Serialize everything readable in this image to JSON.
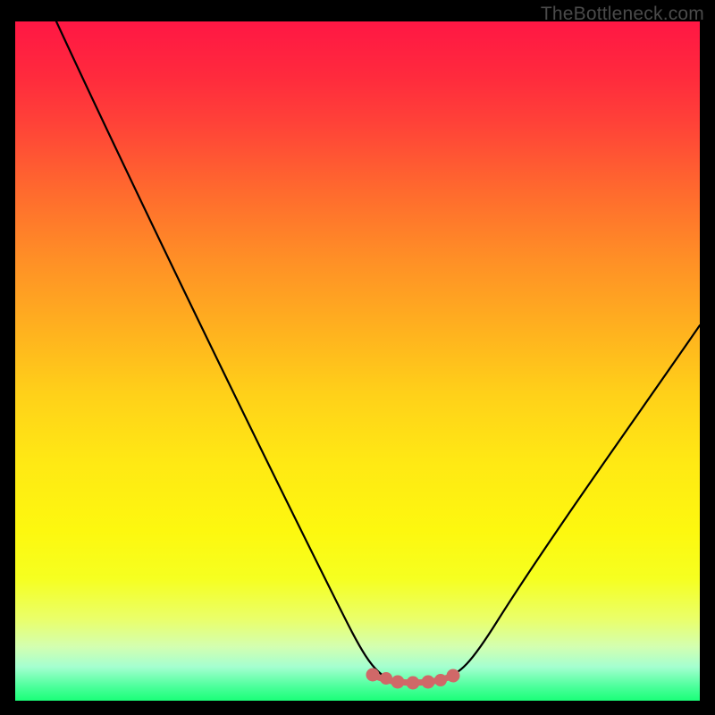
{
  "watermark": "TheBottleneck.com",
  "chart_data": {
    "type": "line",
    "title": "",
    "xlabel": "",
    "ylabel": "",
    "x_range": [
      0,
      100
    ],
    "y_range": [
      0,
      100
    ],
    "series": [
      {
        "name": "curve",
        "color": "#000000",
        "x": [
          6,
          10,
          15,
          20,
          25,
          30,
          35,
          40,
          45,
          48,
          50,
          52,
          55,
          57,
          59,
          61,
          63,
          66,
          70,
          75,
          80,
          85,
          90,
          95,
          100
        ],
        "values": [
          100,
          92,
          83,
          74,
          65,
          56,
          47,
          38,
          28,
          21,
          14,
          8,
          3,
          1,
          0,
          0,
          1,
          3,
          9,
          17,
          25,
          33,
          41,
          48,
          55
        ]
      },
      {
        "name": "optimal-band",
        "color": "#d96a6a",
        "x": [
          52,
          55,
          57,
          59,
          61,
          63,
          66
        ],
        "values": [
          3,
          1,
          0.5,
          0.3,
          0.3,
          0.8,
          2
        ]
      }
    ],
    "gradient_stops": [
      {
        "pos": 0,
        "color": "#ff1744"
      },
      {
        "pos": 50,
        "color": "#ffd119"
      },
      {
        "pos": 85,
        "color": "#f6ff20"
      },
      {
        "pos": 100,
        "color": "#1aff78"
      }
    ]
  }
}
